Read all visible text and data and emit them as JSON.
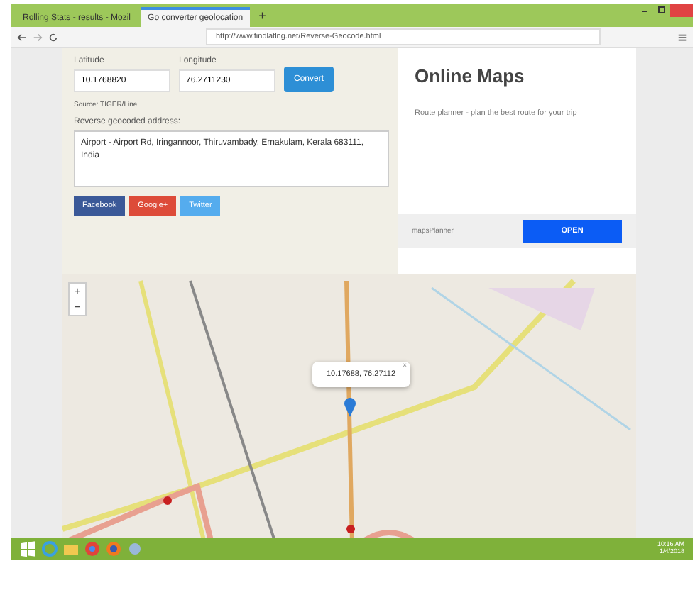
{
  "browser": {
    "tabs": [
      {
        "label": "Rolling Stats - results - Mozil",
        "selected": false
      },
      {
        "label": "Go converter geolocation",
        "selected": true
      }
    ],
    "new_tab": "+",
    "address": "http://www.findlatlng.net/Reverse-Geocode.html"
  },
  "form": {
    "latitude_label": "Latitude",
    "latitude_value": "10.1768820",
    "longitude_label": "Longitude",
    "longitude_value": "76.2711230",
    "convert_button": "Convert",
    "note": "Source: TIGER/Line",
    "address_label": "Reverse geocoded address:",
    "address_value": "Airport - Airport Rd, Iringannoor, Thiruvambady, Ernakulam, Kerala 683111, India",
    "share_buttons": [
      {
        "label": "Facebook",
        "color": "#3b5998"
      },
      {
        "label": "Google+",
        "color": "#dd4b39"
      },
      {
        "label": "Twitter",
        "color": "#55acee"
      }
    ]
  },
  "ad": {
    "title": "Online Maps",
    "text": "Route planner - plan the best route for your trip",
    "source": "mapsPlanner",
    "button": "OPEN"
  },
  "map": {
    "zoom_in": "+",
    "zoom_out": "−",
    "popup": "10.17688, 76.27112",
    "popup_close": "×"
  },
  "taskbar": {
    "time": "10:16 AM",
    "date": "1/4/2018"
  }
}
